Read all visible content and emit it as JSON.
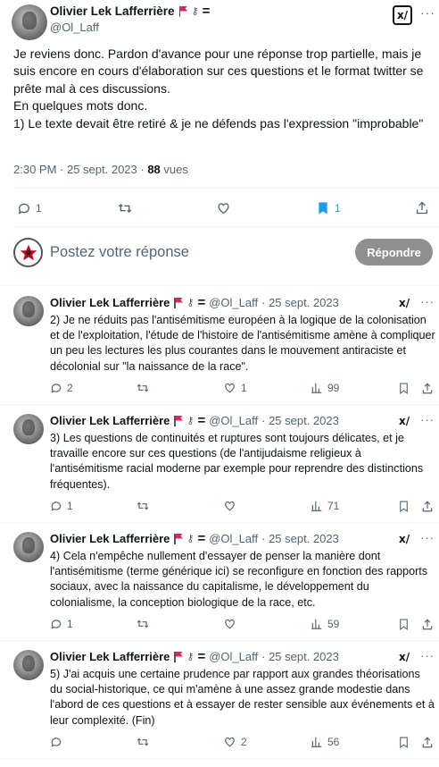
{
  "main_tweet": {
    "author_name": "Olivier Lek Lafferrière",
    "handle": "@Ol_Laff",
    "grok_label": "x/",
    "text": "Je reviens donc. Pardon d'avance pour une réponse trop partielle, mais je suis encore en cours d'élaboration sur ces questions et le format twitter se prête mal à ces discussions.\nEn quelques mots donc.\n1) Le texte devait être retiré & je ne défends pas l'expression \"improbable\"",
    "time": "2:30 PM · 25 sept. 2023 · ",
    "views_count": "88",
    "views_label": " vues",
    "actions": {
      "replies": "1",
      "retweets": "",
      "likes": "",
      "bookmarks": "1"
    },
    "bookmark_color": "#1d9bf0"
  },
  "reply_box": {
    "placeholder": "Postez votre réponse",
    "button_label": "Répondre",
    "button_color": "#8f8f8f"
  },
  "replies": [
    {
      "name": "Olivier Lek Lafferrière",
      "handle": "@Ol_Laff",
      "date": "· 25 sept. 2023",
      "text": "2) Je ne réduits pas l'antisémitisme européen à la logique de la colonisation et de l'exploitation, l'étude de l'histoire de l'antisémitisme amène à compliquer un peu les lectures les plus courantes dans le mouvement antiraciste et décolonial sur \"la naissance de la race\".",
      "replies": "2",
      "retweets": "",
      "likes": "1",
      "views": "99"
    },
    {
      "name": "Olivier Lek Lafferrière",
      "handle": "@Ol_Laff",
      "date": "· 25 sept. 2023",
      "text": "3) Les questions de continuités et ruptures sont toujours délicates, et je travaille encore sur ces questions (de l'antijudaisme religieux à l'antisémitisme racial moderne par exemple pour reprendre des distinctions fréquentes).",
      "replies": "1",
      "retweets": "",
      "likes": "",
      "views": "71"
    },
    {
      "name": "Olivier Lek Lafferrière",
      "handle": "@Ol_Laff",
      "date": "· 25 sept. 2023",
      "text": "4) Cela n'empêche nullement d'essayer de penser la manière dont l'antisémitisme (terme générique ici) se reconfigure en fonction des rapports sociaux, avec la naissance du capitalisme, le développement du colonialisme, la conception biologique de la race, etc.",
      "replies": "1",
      "retweets": "",
      "likes": "",
      "views": "59"
    },
    {
      "name": "Olivier Lek Lafferrière",
      "handle": "@Ol_Laff",
      "date": "· 25 sept. 2023",
      "text": "5) J'ai acquis une certaine prudence par rapport aux grandes théorisations du social-historique, ce qui m'amène à une assez grande modestie dans l'abord de ces questions et à essayer de rester sensible aux événements et à leur complexité. (Fin)",
      "replies": "",
      "retweets": "",
      "likes": "2",
      "views": "56"
    }
  ],
  "icons": {
    "reply": "comment-icon",
    "retweet": "retweet-icon",
    "like": "heart-icon",
    "views": "bar-chart-icon",
    "bookmark": "bookmark-icon",
    "share": "share-icon",
    "more": "more-icon",
    "grok": "grok-icon"
  }
}
